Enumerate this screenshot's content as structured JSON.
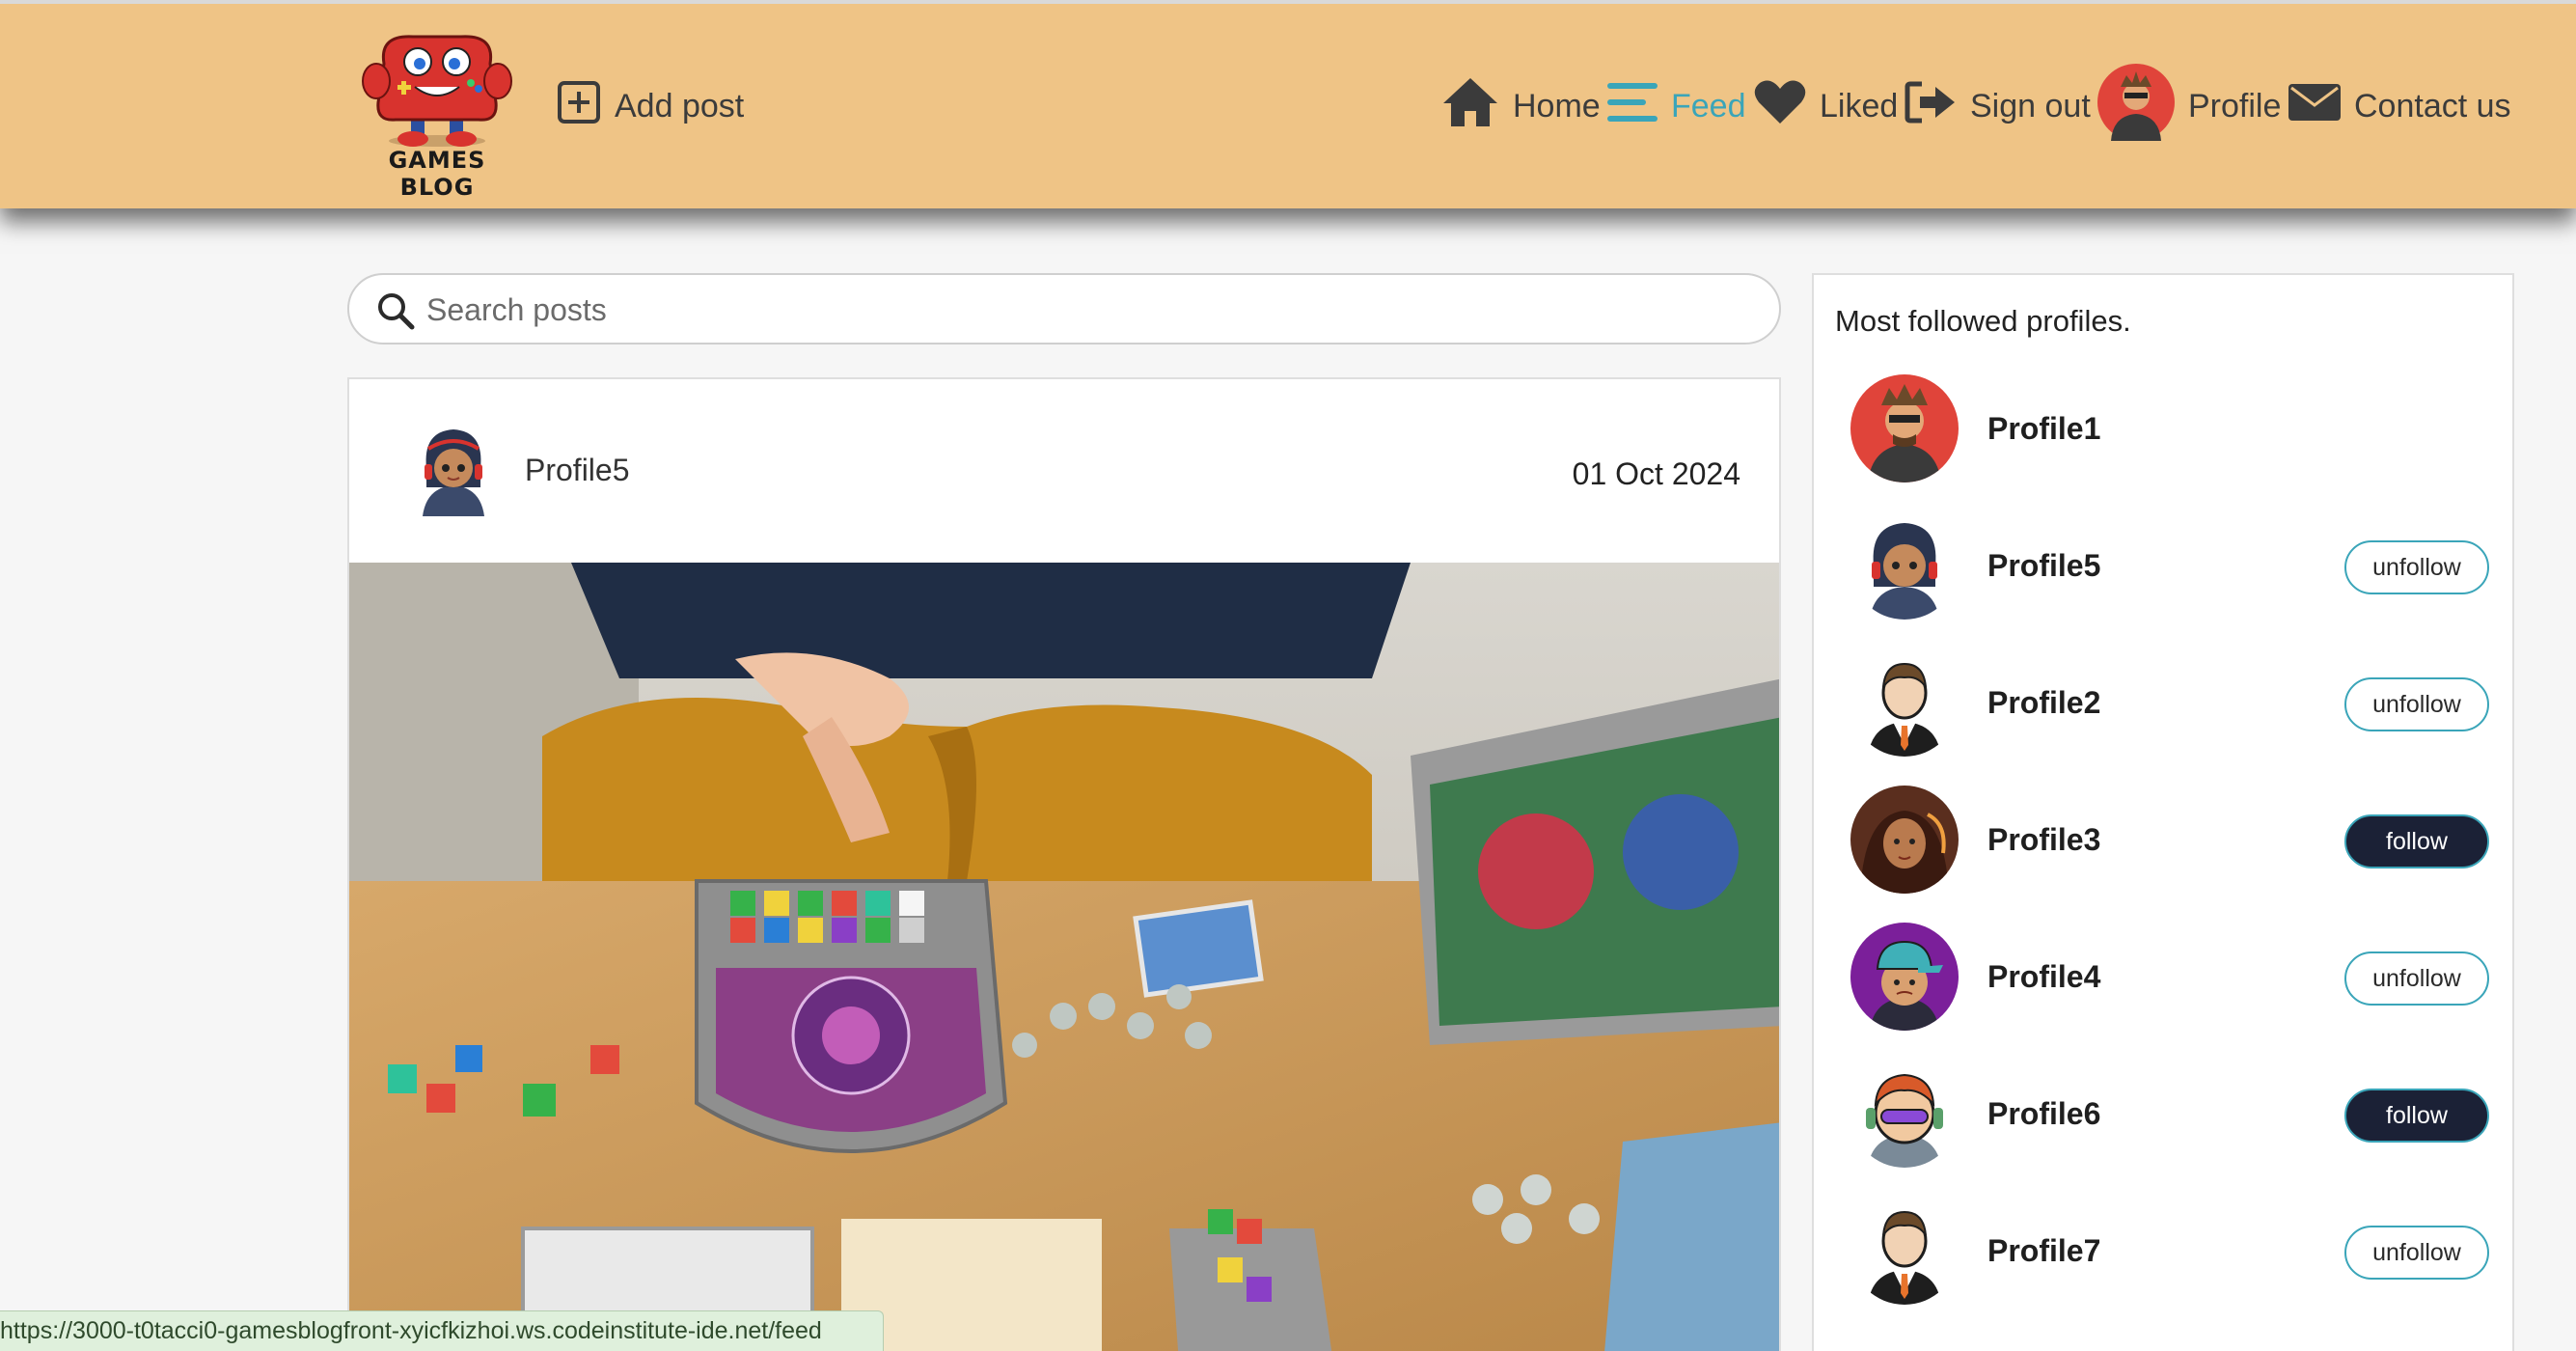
{
  "nav": {
    "logo_text": "GAMES BLOG",
    "add_post": "Add post",
    "home": "Home",
    "feed": "Feed",
    "liked": "Liked",
    "sign_out": "Sign out",
    "profile": "Profile",
    "contact": "Contact us",
    "active_color": "#3aa5b9",
    "bar_color": "#efc486"
  },
  "search": {
    "placeholder": "Search posts"
  },
  "post": {
    "author": "Profile5",
    "date": "01 Oct 2024",
    "image_icon": "board-game-photo"
  },
  "sidebar": {
    "title": "Most followed profiles.",
    "profiles": [
      {
        "name": "Profile1",
        "button": ""
      },
      {
        "name": "Profile5",
        "button": "unfollow"
      },
      {
        "name": "Profile2",
        "button": "unfollow"
      },
      {
        "name": "Profile3",
        "button": "follow"
      },
      {
        "name": "Profile4",
        "button": "unfollow"
      },
      {
        "name": "Profile6",
        "button": "follow"
      },
      {
        "name": "Profile7",
        "button": "unfollow"
      }
    ]
  },
  "status_url": "https://3000-t0tacci0-gamesblogfront-xyicfkizhoi.ws.codeinstitute-ide.net/feed"
}
